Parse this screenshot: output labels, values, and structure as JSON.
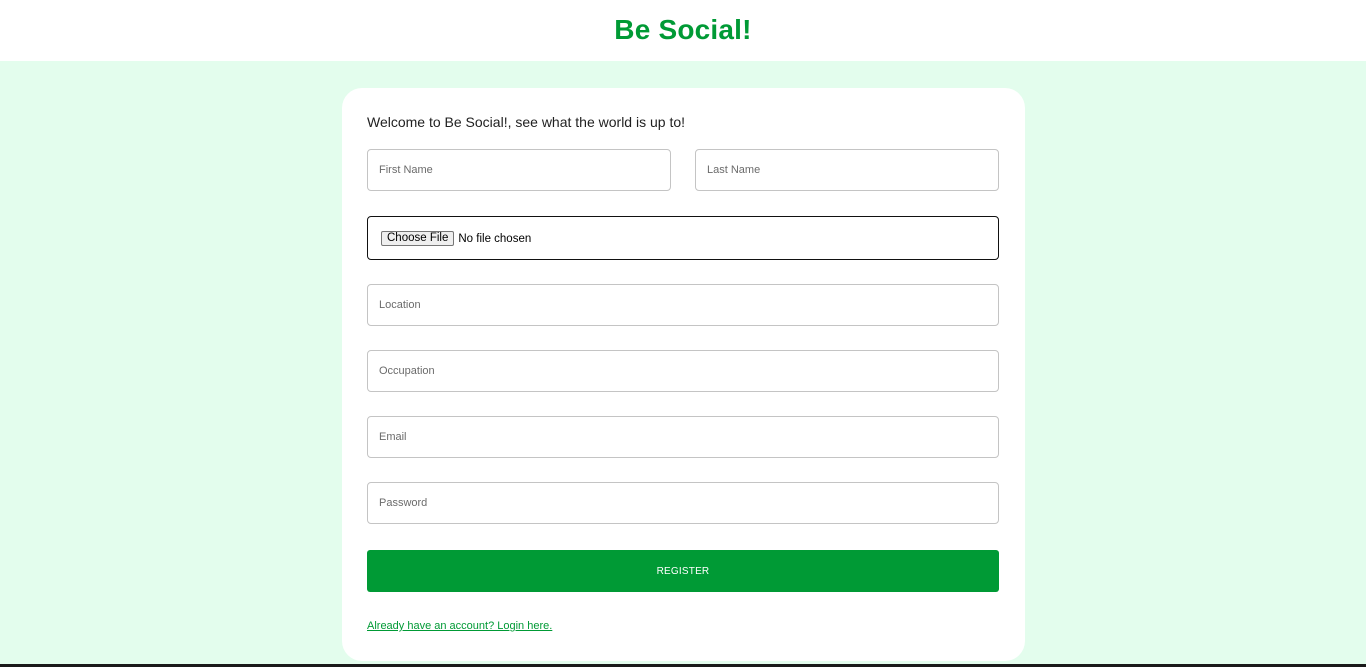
{
  "header": {
    "brand": "Be Social!"
  },
  "form": {
    "welcome": "Welcome to Be Social!, see what the world is up to!",
    "first_name_placeholder": "First Name",
    "last_name_placeholder": "Last Name",
    "file_button_label": "Choose File",
    "file_status": "No file chosen",
    "location_placeholder": "Location",
    "occupation_placeholder": "Occupation",
    "email_placeholder": "Email",
    "password_placeholder": "Password",
    "register_label": "REGISTER",
    "login_link": "Already have an account? Login here."
  },
  "colors": {
    "accent": "#009a35",
    "page_background": "#e3fded",
    "card_background": "#ffffff"
  }
}
